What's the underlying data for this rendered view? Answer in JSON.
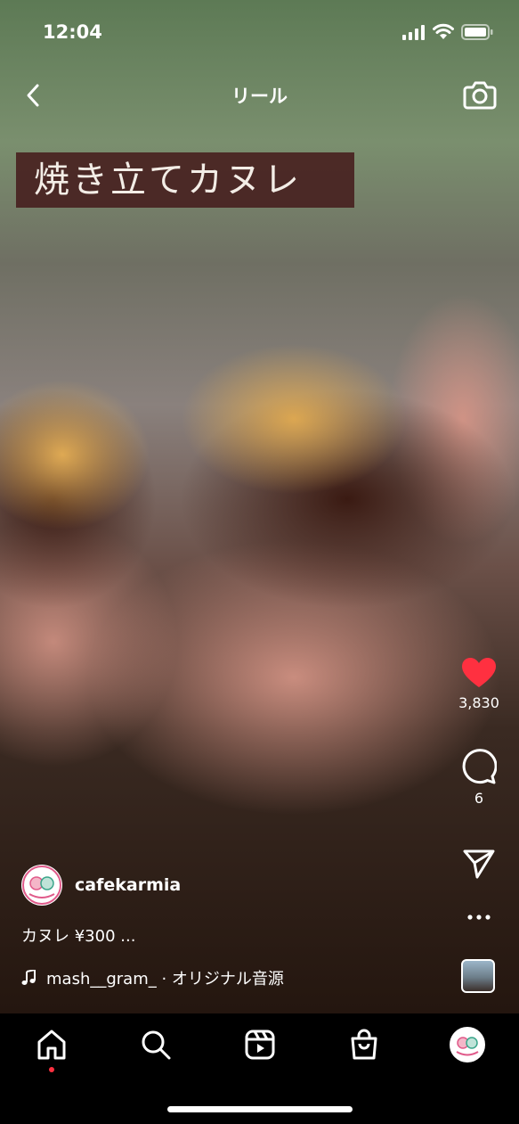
{
  "status_bar": {
    "time": "12:04"
  },
  "header": {
    "title": "リール"
  },
  "video": {
    "overlay_text": "焼き立てカヌレ"
  },
  "actions": {
    "likes": "3,830",
    "comments": "6"
  },
  "post": {
    "username": "cafekarmia",
    "caption": "カヌレ ¥300 ...",
    "audio": "mash__gram_ · オリジナル音源"
  },
  "colors": {
    "like": "#ff3040",
    "overlay_bg": "#461c1c",
    "nav_bg": "#000000"
  },
  "icons": {
    "back": "chevron-left-icon",
    "camera": "camera-icon",
    "like": "heart-icon",
    "comment": "comment-icon",
    "share": "send-icon",
    "more": "more-horizontal-icon",
    "music": "music-note-icon",
    "nav": [
      "home-icon",
      "search-icon",
      "reels-icon",
      "shop-icon",
      "profile-avatar"
    ]
  }
}
